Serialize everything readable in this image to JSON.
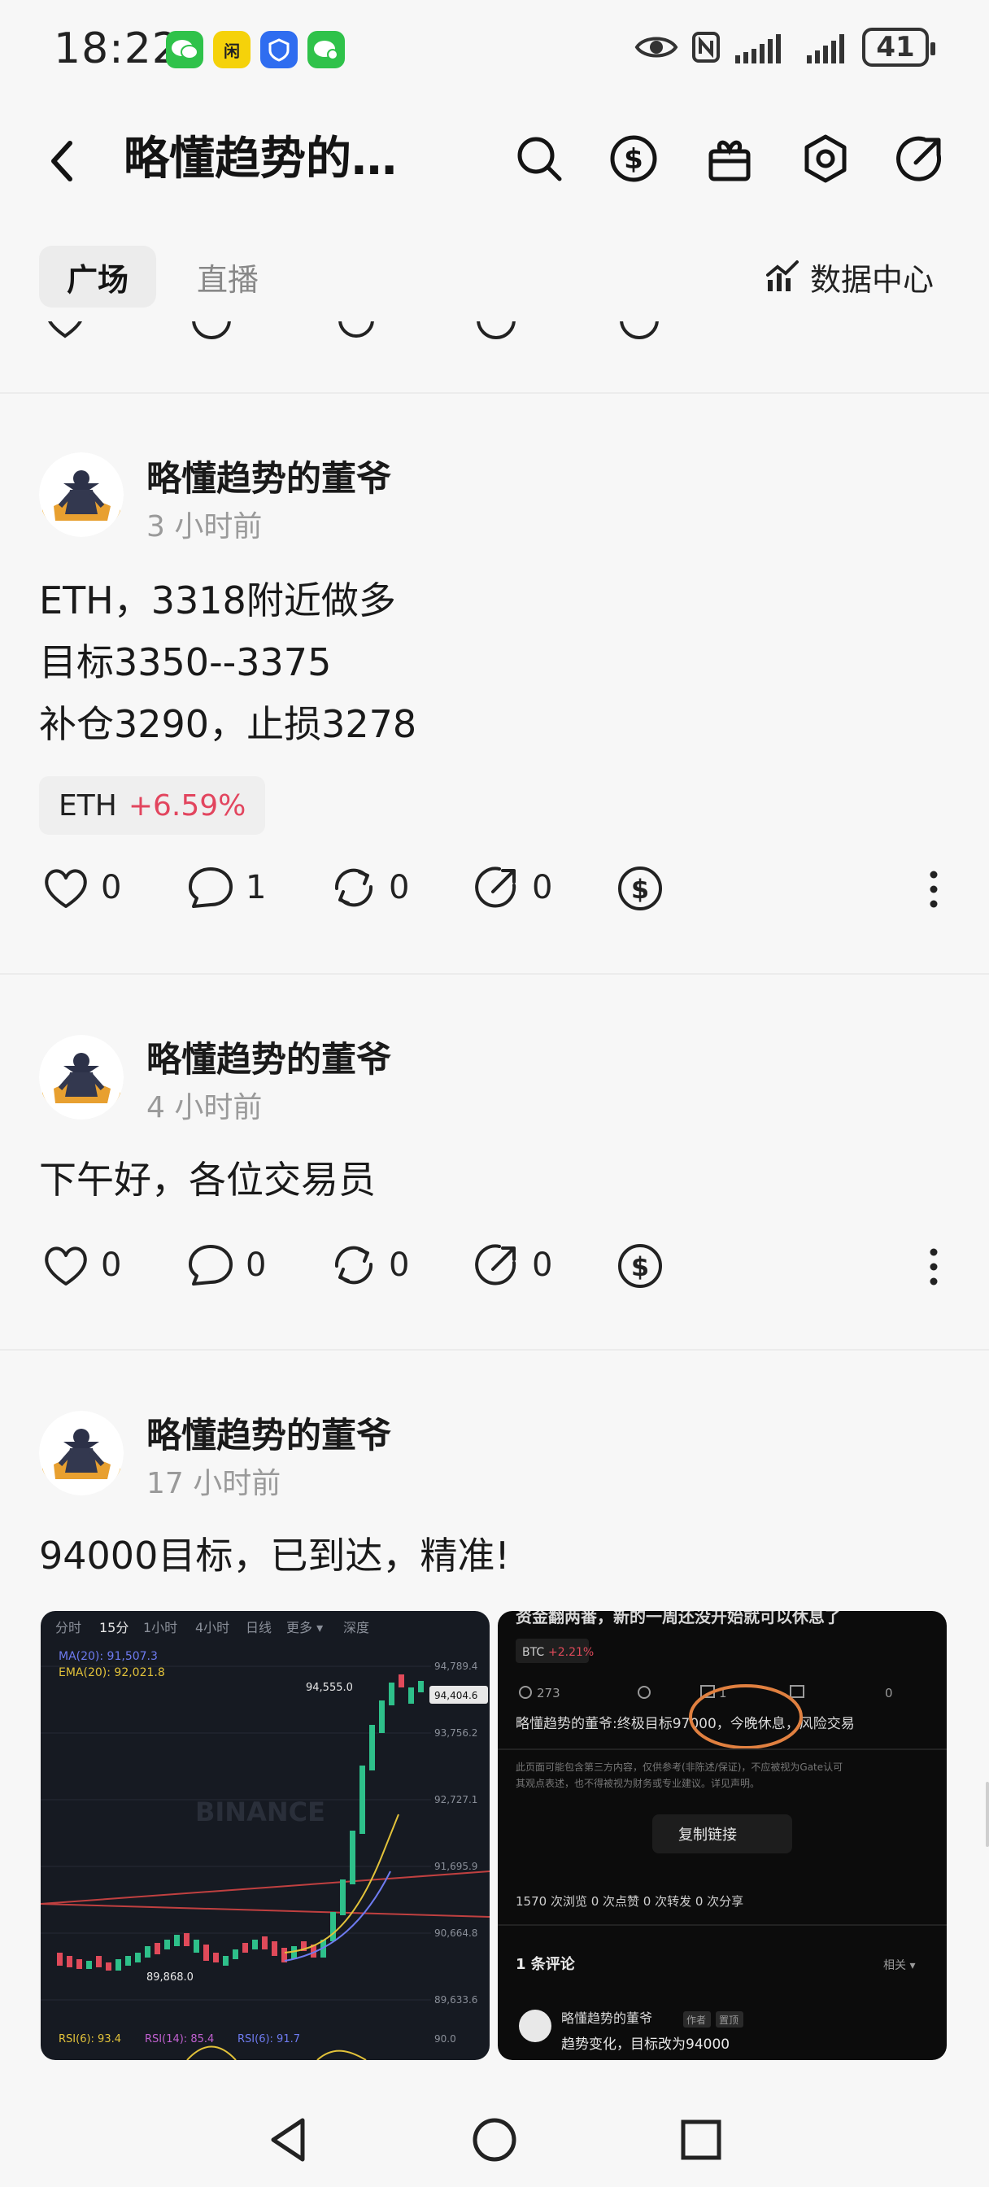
{
  "status_bar": {
    "time": "18:22",
    "battery": "41",
    "icons": [
      "wechat-icon",
      "app-icon",
      "security-app-icon",
      "wechat-pay-icon",
      "eye-icon",
      "nfc-icon",
      "signal-icon",
      "signal-icon-2"
    ]
  },
  "header": {
    "title": "略懂趋势的…",
    "icons": [
      "back-icon",
      "search-icon",
      "dollar-icon",
      "gift-icon",
      "settings-icon",
      "share-icon"
    ]
  },
  "tabs": [
    {
      "label": "广场",
      "active": true
    },
    {
      "label": "直播",
      "active": false
    }
  ],
  "data_center_label": "数据中心",
  "posts": [
    {
      "author": "略懂趋势的董爷",
      "time": "3 小时前",
      "lines": [
        "ETH，3318附近做多",
        "目标3350--3375",
        "补仓3290，止损3278"
      ],
      "tag": {
        "symbol": "ETH",
        "change": "+6.59%"
      },
      "likes": "0",
      "comments": "1",
      "reposts": "0",
      "shares": "0"
    },
    {
      "author": "略懂趋势的董爷",
      "time": "4 小时前",
      "lines": [
        "下午好，各位交易员"
      ],
      "likes": "0",
      "comments": "0",
      "reposts": "0",
      "shares": "0"
    },
    {
      "author": "略懂趋势的董爷",
      "time": "17 小时前",
      "lines": [
        "94000目标，已到达，精准!"
      ],
      "chart_image": {
        "tabs": [
          "分时",
          "15分",
          "1小时",
          "4小时",
          "日线",
          "更多 ▾",
          "深度"
        ],
        "ma": "MA(20): 91,507.3",
        "ema": "EMA(20): 92,021.8",
        "watermark": "BINANCE",
        "price_labels": [
          "94,789.4",
          "94,404.6",
          "93,756.2",
          "92,727.1",
          "91,695.9",
          "90,664.8",
          "89,633.6",
          "90.0"
        ],
        "high_label": "94,555.0",
        "low_label": "89,868.0",
        "rsi": [
          "RSI(6): 93.4",
          "RSI(14): 85.4",
          "RSI(6): 91.7"
        ]
      },
      "screenshot_image": {
        "header": "资金翻两番，新的一周还没开始就可以休息了",
        "tag": "BTC",
        "tag_change": "+2.21%",
        "stats": [
          "273",
          "1",
          "0"
        ],
        "post_line": "略懂趋势的董爷:终极目标97000，今晚休息，风险交易",
        "disclaimer_1": "此页面可能包含第三方内容，仅供参考(非陈述/保证)，不应被视为Gate认可",
        "disclaimer_2": "其观点表述，也不得被视为财务或专业建议。详见声明。",
        "copy_button": "复制链接",
        "counts": "1570 次浏览  0 次点赞  0 次转发  0 次分享",
        "comment_header": "1 条评论",
        "sort": "相关 ▾",
        "commenter": "略懂趋势的董爷",
        "badge1": "作者",
        "badge2": "置顶",
        "comment": "趋势变化，目标改为94000"
      }
    }
  ]
}
